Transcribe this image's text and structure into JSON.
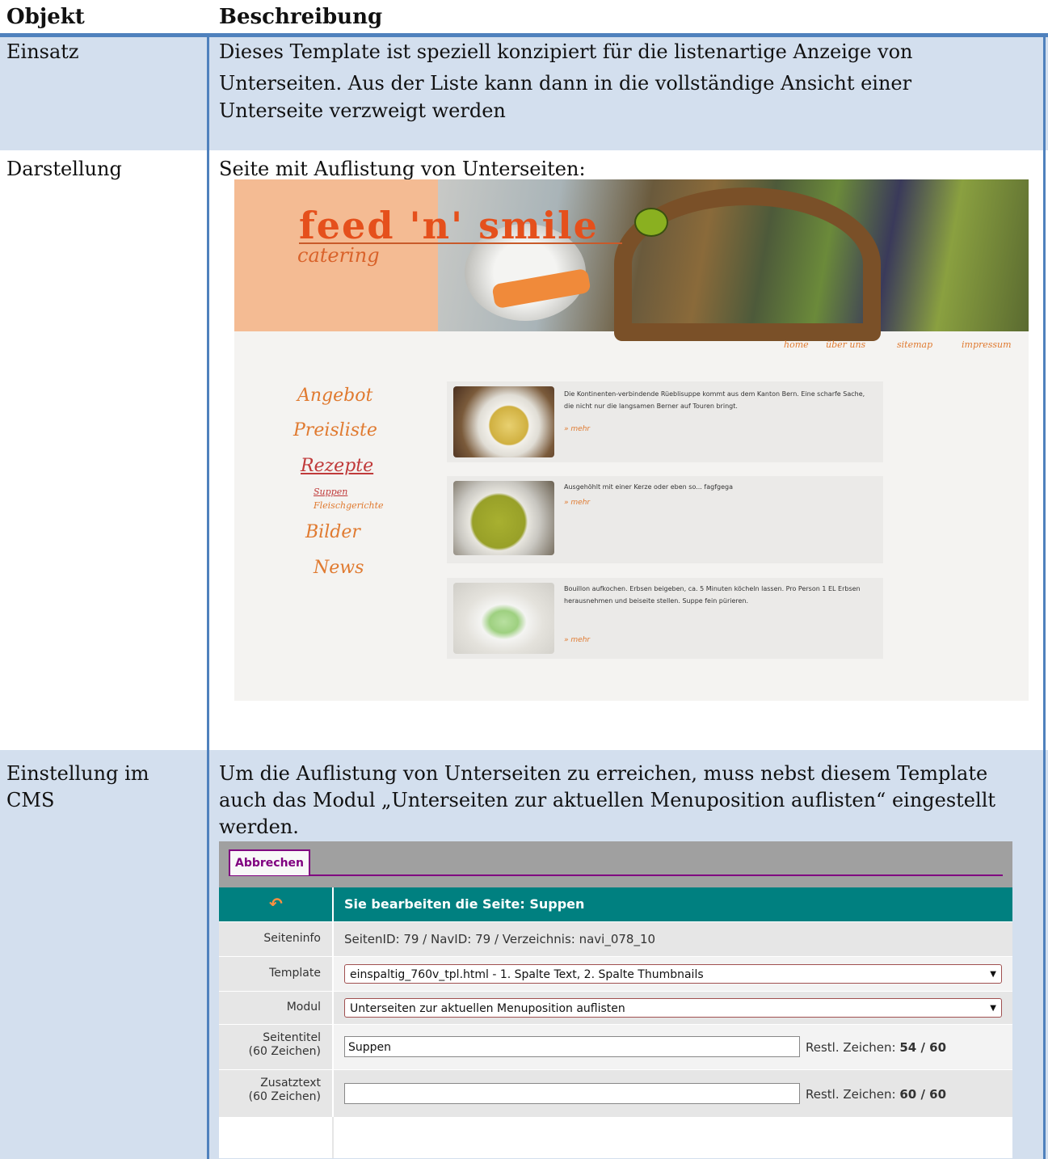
{
  "table": {
    "header_object": "Objekt",
    "header_description": "Beschreibung"
  },
  "rows": {
    "einsatz_label": "Einsatz",
    "einsatz_text_1": "Dieses Template ist speziell konzipiert für die listenartige Anzeige von",
    "einsatz_text_2": "Unterseiten. Aus der Liste kann dann in die vollständige Ansicht einer",
    "einsatz_text_3": "Unterseite verzweigt werden",
    "darstellung_label": "Darstellung",
    "darstellung_text": "Seite mit Auflistung von Unterseiten:",
    "einstellung_label_1": "Einstellung im",
    "einstellung_label_2": "CMS",
    "einstellung_text_1": "Um die Auflistung von Unterseiten zu erreichen, muss nebst diesem Template",
    "einstellung_text_2": "auch das Modul „Unterseiten zur aktuellen Menuposition auflisten“ eingestellt",
    "einstellung_text_3": "werden."
  },
  "site": {
    "logo_title": "feed 'n' smile",
    "logo_sub": "catering",
    "topnav": [
      "home",
      "über uns",
      "sitemap",
      "impressum"
    ],
    "leftnav": [
      "Angebot",
      "Preisliste",
      "Rezepte",
      "Bilder",
      "News"
    ],
    "subnav": [
      "Suppen",
      "Fleischgerichte"
    ],
    "cards": [
      {
        "text": "Die Kontinenten-verbindende Rüeblisuppe kommt aus dem Kanton Bern. Eine scharfe Sache, die nicht nur die langsamen Berner auf Touren bringt.",
        "more": "» mehr"
      },
      {
        "text": "Ausgehöhlt mit einer Kerze oder eben so... fagfgega",
        "more": "» mehr"
      },
      {
        "text": "Bouillon aufkochen. Erbsen beigeben, ca. 5 Minuten köcheln lassen. Pro Person 1 EL Erbsen herausnehmen und beiseite stellen. Suppe fein pürieren.",
        "more": "» mehr"
      }
    ]
  },
  "cms": {
    "tab_cancel": "Abbrechen",
    "head_title": "Sie bearbeiten die Seite: Suppen",
    "seiteninfo_label": "Seiteninfo",
    "seiteninfo_value": "SeitenID: 79 / NavID: 79 / Verzeichnis: navi_078_10",
    "template_label": "Template",
    "template_value": "einspaltig_760v_tpl.html - 1. Spalte Text, 2. Spalte Thumbnails",
    "modul_label": "Modul",
    "modul_value": "Unterseiten zur aktuellen Menuposition auflisten",
    "seitentitel_label": "Seitentitel",
    "seitentitel_hint": "(60 Zeichen)",
    "seitentitel_value": "Suppen",
    "seitentitel_restl": "Restl. Zeichen:",
    "seitentitel_count": "54 / 60",
    "zusatztext_label": "Zusatztext",
    "zusatztext_hint": "(60 Zeichen)",
    "zusatztext_value": "",
    "zusatztext_restl": "Restl. Zeichen:",
    "zusatztext_count": "60 / 60"
  },
  "colors": {
    "accent_blue": "#4f81bd",
    "band_blue": "#d3dfee",
    "cms_teal": "#008080",
    "cms_purple": "#800080",
    "site_orange": "#e07a30"
  },
  "icons": {
    "back_icon": "back-arrow-icon",
    "dropdown_icon": "chevron-down-icon"
  }
}
